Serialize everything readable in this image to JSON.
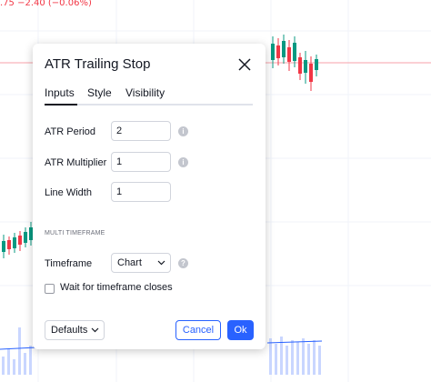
{
  "ticker": {
    "text": ".75 −2.40 (−0.06%)"
  },
  "dialog": {
    "title": "ATR Trailing Stop",
    "tabs": [
      {
        "label": "Inputs",
        "active": true
      },
      {
        "label": "Style",
        "active": false
      },
      {
        "label": "Visibility",
        "active": false
      }
    ],
    "inputs": {
      "atr_period": {
        "label": "ATR Period",
        "value": "2"
      },
      "atr_multiplier": {
        "label": "ATR Multiplier",
        "value": "1"
      },
      "line_width": {
        "label": "Line Width",
        "value": "1"
      }
    },
    "section_label": "MULTI TIMEFRAME",
    "timeframe": {
      "label": "Timeframe",
      "value": "Chart"
    },
    "wait_checkbox": {
      "label": "Wait for timeframe closes",
      "checked": false
    },
    "footer": {
      "defaults_label": "Defaults",
      "cancel_label": "Cancel",
      "ok_label": "Ok"
    }
  },
  "colors": {
    "accent": "#2962ff",
    "up": "#089981",
    "down": "#f23645",
    "info_icon": "#c3c6ce"
  }
}
